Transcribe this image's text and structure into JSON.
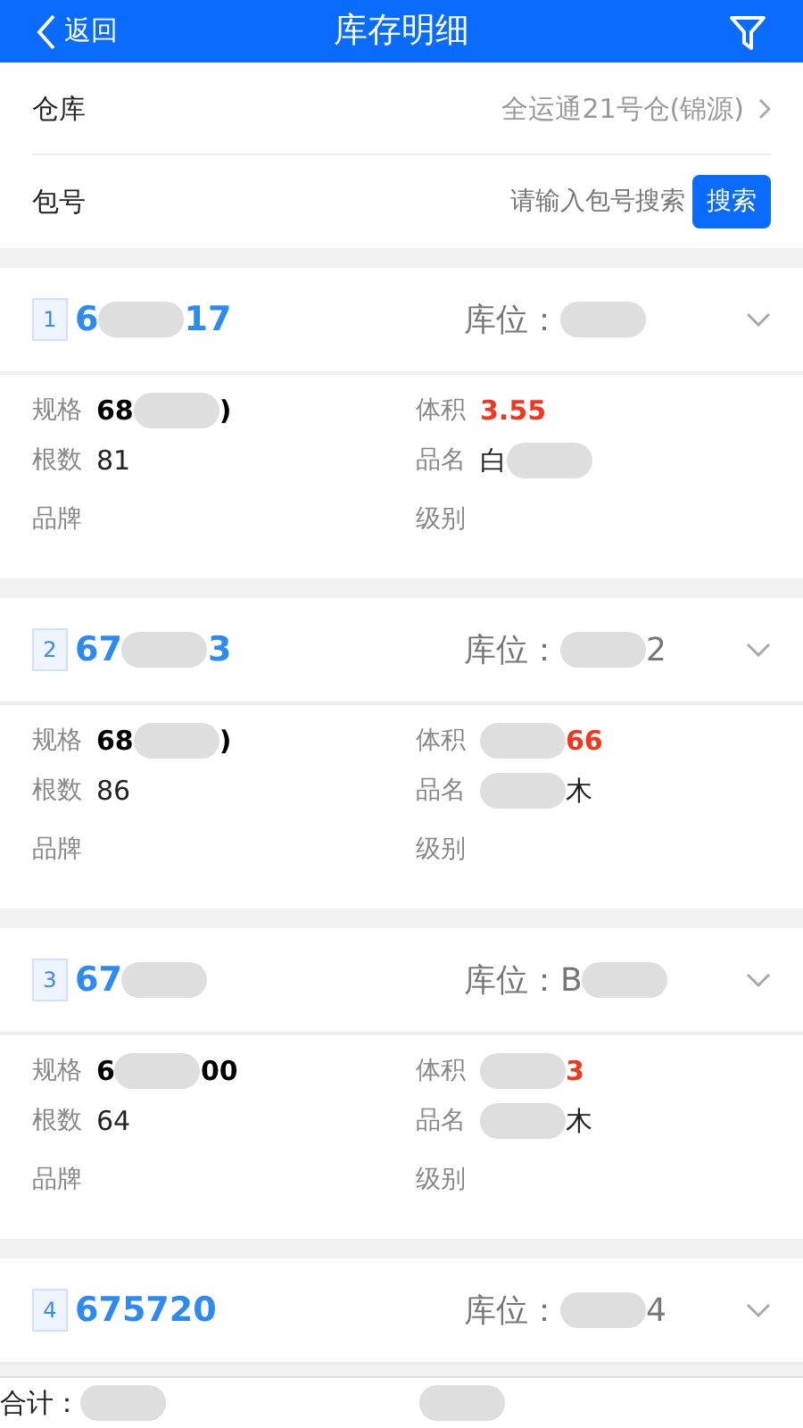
{
  "header": {
    "back": "返回",
    "title": "库存明细"
  },
  "filters": [
    {
      "kind": "select",
      "label": "仓库",
      "value": "全运通21号仓(锦源)"
    },
    {
      "kind": "search",
      "label": "包号",
      "placeholder": "请输入包号搜索",
      "button": "搜索"
    }
  ],
  "items": [
    {
      "index": "1",
      "code": [
        {
          "text": "6"
        },
        {
          "kind": "blur"
        },
        {
          "text": "17"
        }
      ],
      "location_label": "库位：",
      "location": [
        {
          "kind": "blur"
        }
      ],
      "fields": [
        {
          "label": "规格",
          "value": [
            {
              "text": "68"
            },
            {
              "kind": "blur"
            },
            {
              "text": ")"
            }
          ],
          "kind": "bold"
        },
        {
          "label": "体积",
          "value": [
            {
              "text": "3.55"
            }
          ],
          "kind": "red"
        },
        {
          "label": "根数",
          "value": [
            {
              "text": "81"
            }
          ],
          "kind": "plain"
        },
        {
          "label": "品名",
          "value": [
            {
              "text": "白"
            },
            {
              "kind": "blur"
            }
          ],
          "kind": "plain"
        },
        {
          "label": "品牌"
        },
        {
          "label": "级别"
        }
      ]
    },
    {
      "index": "2",
      "code": [
        {
          "text": "67"
        },
        {
          "kind": "blur"
        },
        {
          "text": "3"
        }
      ],
      "location_label": "库位：",
      "location": [
        {
          "kind": "blur"
        },
        {
          "text": "2"
        }
      ],
      "fields": [
        {
          "label": "规格",
          "value": [
            {
              "text": "68"
            },
            {
              "kind": "blur"
            },
            {
              "text": ")"
            }
          ],
          "kind": "bold"
        },
        {
          "label": "体积",
          "value": [
            {
              "kind": "blur"
            },
            {
              "text": "66"
            }
          ],
          "kind": "red"
        },
        {
          "label": "根数",
          "value": [
            {
              "text": "86"
            }
          ],
          "kind": "plain"
        },
        {
          "label": "品名",
          "value": [
            {
              "kind": "blur"
            },
            {
              "text": "木"
            }
          ],
          "kind": "plain"
        },
        {
          "label": "品牌"
        },
        {
          "label": "级别"
        }
      ]
    },
    {
      "index": "3",
      "code": [
        {
          "text": "67"
        },
        {
          "kind": "blur"
        }
      ],
      "location_label": "库位：",
      "location": [
        {
          "text": "B"
        },
        {
          "kind": "blur"
        }
      ],
      "fields": [
        {
          "label": "规格",
          "value": [
            {
              "text": "6"
            },
            {
              "kind": "blur"
            },
            {
              "text": "00"
            }
          ],
          "kind": "bold"
        },
        {
          "label": "体积",
          "value": [
            {
              "kind": "blur"
            },
            {
              "text": "3"
            }
          ],
          "kind": "red"
        },
        {
          "label": "根数",
          "value": [
            {
              "text": "64"
            }
          ],
          "kind": "plain"
        },
        {
          "label": "品名",
          "value": [
            {
              "kind": "blur"
            },
            {
              "text": "木"
            }
          ],
          "kind": "plain"
        },
        {
          "label": "品牌"
        },
        {
          "label": "级别"
        }
      ]
    },
    {
      "index": "4",
      "code": [
        {
          "text": "675720"
        }
      ],
      "location_label": "库位：",
      "location": [
        {
          "kind": "blur"
        },
        {
          "text": "4"
        }
      ]
    }
  ],
  "footer": {
    "label": "合计：",
    "parts": [
      [
        {
          "kind": "blur"
        }
      ],
      [
        {
          "kind": "blur"
        }
      ]
    ]
  }
}
